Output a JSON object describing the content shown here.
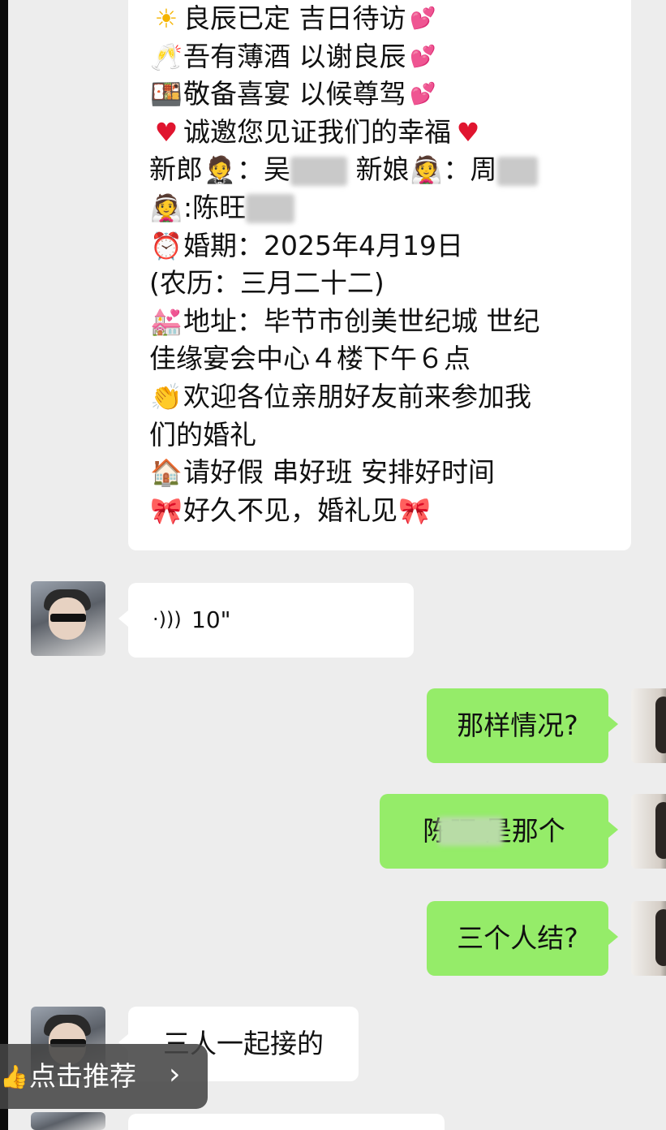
{
  "invitation": {
    "line1": "良辰已定 吉日待访",
    "line2": "吾有薄酒 以谢良辰",
    "line3": "敬备喜宴 以候尊驾",
    "line4": "诚邀您见证我们的幸福",
    "groom_label": "新郎",
    "groom_name": "：吴",
    "bride_label": "新娘",
    "bride_name": "：周",
    "extra_name": ":陈旺",
    "date": "婚期：2025年4月19日",
    "lunar": "(农历：三月二十二)",
    "address_1": "地址：毕节市创美世纪城 世纪",
    "address_2": "佳缘宴会中心４楼下午６点",
    "welcome_1": "欢迎各位亲朋好友前来参加我",
    "welcome_2": "们的婚礼",
    "arrange": "请好假 串好班 安排好时间",
    "closing": "好久不见，婚礼见"
  },
  "icons": {
    "sun": "sun-icon",
    "toast": "champagne-icon",
    "bento": "feast-box-icon",
    "heart": "red-heart-icon",
    "pink_hearts": "pink-hearts-icon",
    "groom": "groom-icon",
    "bride": "bride-icon",
    "alarm": "alarm-clock-icon",
    "chapel": "wedding-chapel-icon",
    "clap": "clapping-hands-icon",
    "house": "house-icon",
    "bow": "ribbon-icon"
  },
  "messages": [
    {
      "side": "left",
      "type": "voice",
      "text": "10\""
    },
    {
      "side": "right",
      "type": "text",
      "text": "那样情况?"
    },
    {
      "side": "right",
      "type": "text",
      "text": "陈旺 是那个"
    },
    {
      "side": "right",
      "type": "text",
      "text": "三个人结?"
    },
    {
      "side": "left",
      "type": "text",
      "text": "三人一起接的"
    }
  ],
  "overlay": {
    "recommend_label": "点击推荐",
    "arrow": "›"
  },
  "colors": {
    "background": "#ededed",
    "incoming_bubble": "#ffffff",
    "outgoing_bubble": "#95ec69",
    "heart": "#e0152f"
  }
}
